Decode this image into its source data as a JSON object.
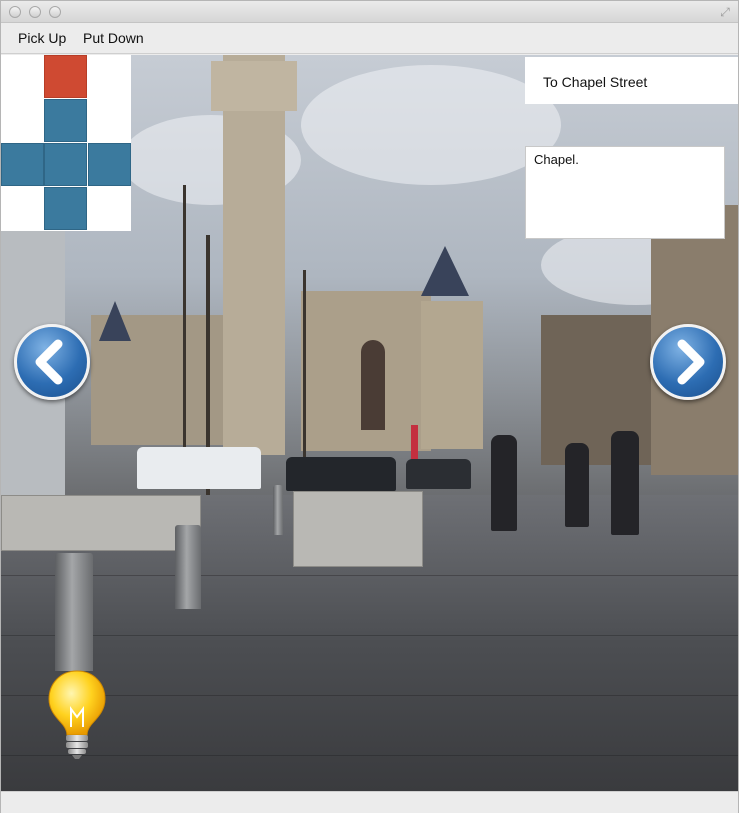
{
  "window": {
    "resize_icon": "fullscreen-arrows-icon"
  },
  "menu": {
    "pick_up_label": "Pick Up",
    "put_down_label": "Put Down"
  },
  "location": {
    "destination_label": "To Chapel Street",
    "description": "Chapel."
  },
  "controls": {
    "back_icon": "chevron-left-icon",
    "forward_icon": "chevron-right-icon",
    "hint_icon": "lightbulb-icon"
  },
  "minimap": {
    "colors": {
      "tile": "#3b7a9e",
      "current": "#cf4a32"
    }
  }
}
